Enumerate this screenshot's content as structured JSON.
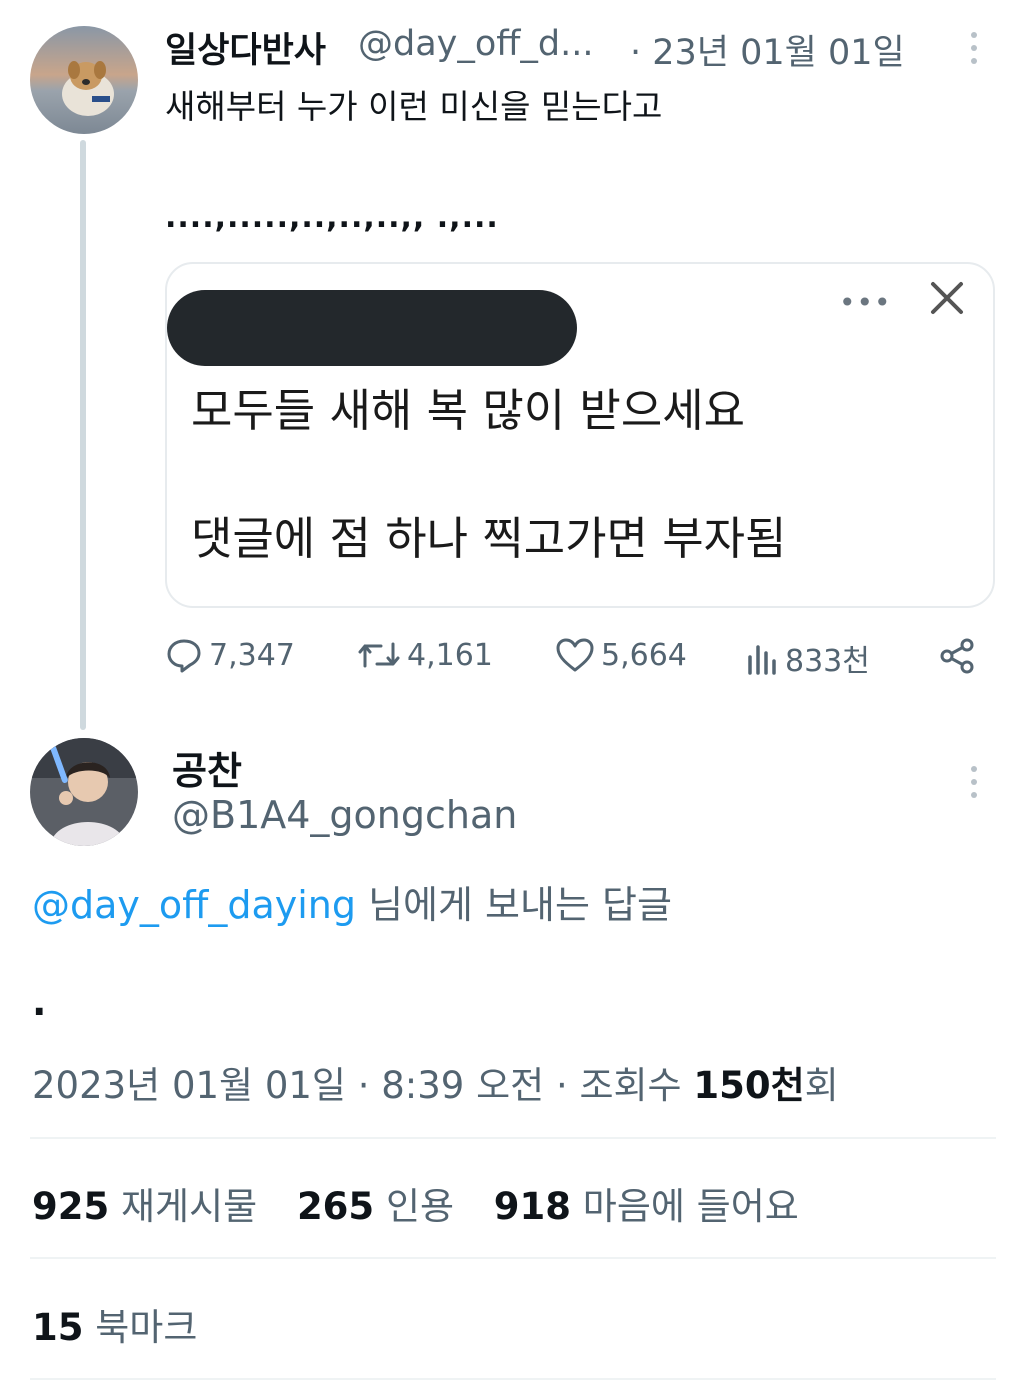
{
  "parent_tweet": {
    "display_name": "일상다반사",
    "handle": "@day_off_d...",
    "date": "· 23년 01월 01일",
    "text": "새해부터 누가 이런 미신을 믿는다고",
    "dots": "....,.....,..,..,..,, .,...",
    "quoted_card": {
      "line1": "모두들 새해 복 많이 받으세요",
      "line2": "댓글에 점 하나 찍고가면 부자됨",
      "more_icon": "ellipsis-icon",
      "close_icon": "close-icon"
    },
    "actions": {
      "replies": "7,347",
      "retweets": "4,161",
      "likes": "5,664",
      "views": "833천"
    }
  },
  "reply_tweet": {
    "display_name": "공찬",
    "handle": "@B1A4_gongchan",
    "reply_to_mention": "@day_off_daying",
    "reply_to_suffix": " 님에게 보내는 답글",
    "text": ".",
    "datetime": "2023년 01월 01일 · 8:39 오전 · 조회수 ",
    "views_count": "150천",
    "views_suffix": "회",
    "stats": {
      "retweets_count": "925",
      "retweets_label": "재게시물",
      "quotes_count": "265",
      "quotes_label": "인용",
      "likes_count": "918",
      "likes_label": "마음에 들어요",
      "bookmarks_count": "15",
      "bookmarks_label": "북마크"
    }
  },
  "colors": {
    "link": "#1d9bf0",
    "secondary_text": "#536471",
    "primary_text": "#0f1419"
  }
}
